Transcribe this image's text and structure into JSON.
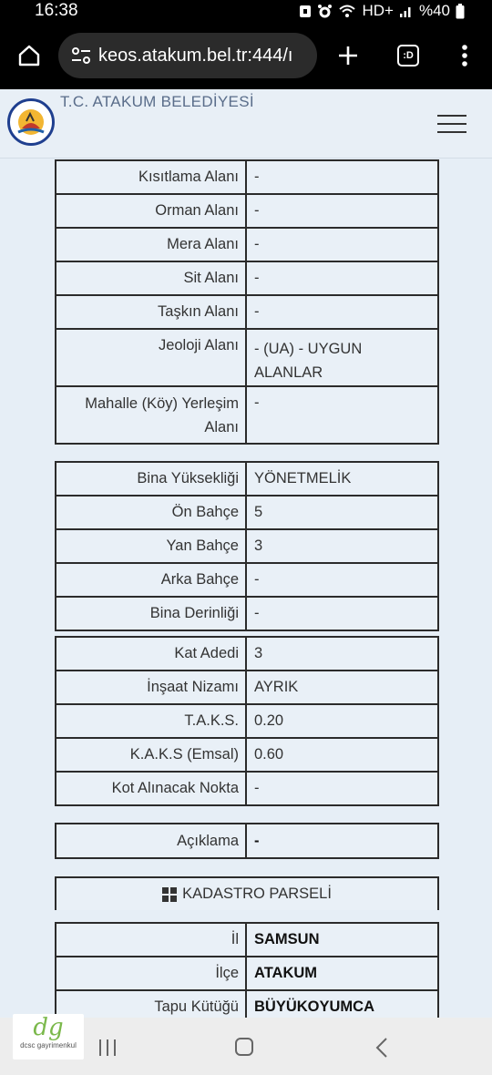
{
  "status_bar": {
    "time": "16:38",
    "network": "HD+",
    "battery": "%40"
  },
  "browser": {
    "url": "keos.atakum.bel.tr:444/ı",
    "tab_count": ":D"
  },
  "site": {
    "title": "T.C. ATAKUM BELEDİYESİ"
  },
  "table_areas": [
    {
      "label": "Kısıtlama Alanı",
      "value": "-"
    },
    {
      "label": "Orman Alanı",
      "value": "-"
    },
    {
      "label": "Mera Alanı",
      "value": "-"
    },
    {
      "label": "Sit Alanı",
      "value": "-"
    },
    {
      "label": "Taşkın Alanı",
      "value": "-"
    },
    {
      "label": "Jeoloji Alanı",
      "value": "- (UA) - UYGUN ALANLAR"
    },
    {
      "label": "Mahalle (Köy) Yerleşim Alanı",
      "value": "-"
    }
  ],
  "table_setbacks": [
    {
      "label": "Bina Yüksekliği",
      "value": "YÖNETMELİK"
    },
    {
      "label": "Ön Bahçe",
      "value": "5"
    },
    {
      "label": "Yan Bahçe",
      "value": "3"
    },
    {
      "label": "Arka Bahçe",
      "value": "-"
    },
    {
      "label": "Bina Derinliği",
      "value": "-"
    }
  ],
  "table_construction": [
    {
      "label": "Kat Adedi",
      "value": "3"
    },
    {
      "label": "İnşaat Nizamı",
      "value": "AYRIK"
    },
    {
      "label": "T.A.K.S.",
      "value": "0.20"
    },
    {
      "label": "K.A.K.S (Emsal)",
      "value": "0.60"
    },
    {
      "label": "Kot Alınacak Nokta",
      "value": "-"
    }
  ],
  "table_note": [
    {
      "label": "Açıklama",
      "value": "-"
    }
  ],
  "cadastre": {
    "heading": "KADASTRO PARSELİ",
    "rows": [
      {
        "label": "İl",
        "value": "SAMSUN"
      },
      {
        "label": "İlçe",
        "value": "ATAKUM"
      },
      {
        "label": "Tapu Kütüğü",
        "value": "BÜYÜKOYUMCA"
      }
    ]
  },
  "watermark": {
    "monogram": "dg",
    "text": "dcsc gayrimenkul"
  },
  "colors": {
    "table_border": "#2b2b2b",
    "page_bg": "#e6eef6",
    "title": "#5a6d8a"
  }
}
